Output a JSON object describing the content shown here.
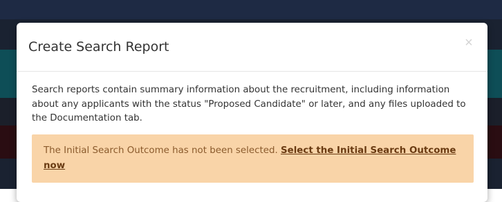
{
  "modal": {
    "title": "Create Search Report",
    "close_icon": "close-icon",
    "close_glyph": "×",
    "description": "Search reports contain summary information about the recruitment, including information about any applicants with the status \"Proposed Candidate\" or later, and any files uploaded to the Documentation tab.",
    "alert": {
      "message": "The Initial Search Outcome has not been selected.",
      "link_label": "Select the Initial Search Outcome now"
    }
  },
  "colors": {
    "alert_background": "#f9d4a8",
    "alert_text": "#8a5a2c",
    "teal_band": "#0e4e57",
    "maroon_band": "#2a0d12"
  }
}
